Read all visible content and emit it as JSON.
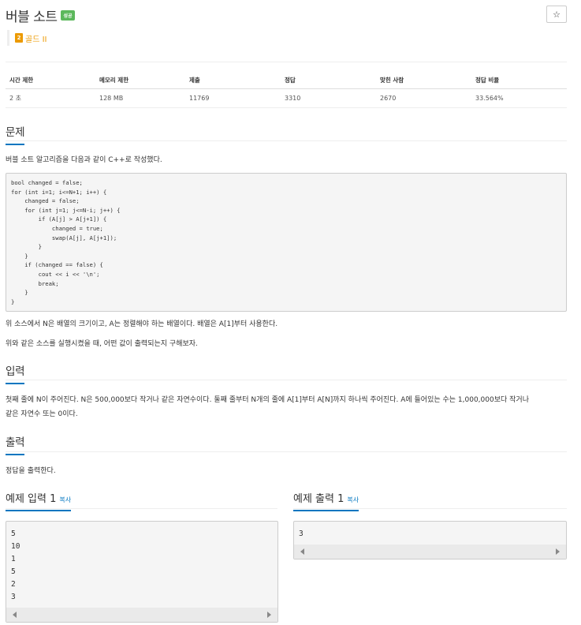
{
  "header": {
    "title": "버블 소트",
    "badge": "성공",
    "star_icon": "☆",
    "tier_number": "2",
    "tier_label": "골드 II"
  },
  "info_table": {
    "headers": [
      "시간 제한",
      "메모리 제한",
      "제출",
      "정답",
      "맞힌 사람",
      "정답 비율"
    ],
    "row": [
      "2 초",
      "128 MB",
      "11769",
      "3310",
      "2670",
      "33.564%"
    ]
  },
  "problem": {
    "heading": "문제",
    "intro": "버블 소트 알고리즘을 다음과 같이 C++로 작성했다.",
    "code": "bool changed = false;\nfor (int i=1; i<=N+1; i++) {\n    changed = false;\n    for (int j=1; j<=N-i; j++) {\n        if (A[j] > A[j+1]) {\n            changed = true;\n            swap(A[j], A[j+1]);\n        }\n    }\n    if (changed == false) {\n        cout << i << '\\n';\n        break;\n    }\n}",
    "desc1": "위 소스에서 N은 배열의 크기이고, A는 정렬해야 하는 배열이다. 배열은 A[1]부터 사용한다.",
    "desc2": "위와 같은 소스를 실행시켰을 때, 어떤 값이 출력되는지 구해보자."
  },
  "input": {
    "heading": "입력",
    "line1": "첫째 줄에 N이 주어진다. N은 500,000보다 작거나 같은 자연수이다. 둘째 줄부터 N개의 줄에 A[1]부터 A[N]까지 하나씩 주어진다. A에 들어있는 수는 1,000,000보다 작거나",
    "line2": "같은 자연수 또는 0이다."
  },
  "output": {
    "heading": "출력",
    "text": "정답을 출력한다."
  },
  "samples": {
    "input_heading": "예제 입력 1",
    "output_heading": "예제 출력 1",
    "copy_label": "복사",
    "input_lines": [
      "5",
      "10",
      "1",
      "5",
      "2",
      "3"
    ],
    "output_lines": [
      "3"
    ]
  },
  "colors": {
    "accent": "#0076c0",
    "success": "#5cb85c",
    "gold": "#ec9a00"
  }
}
